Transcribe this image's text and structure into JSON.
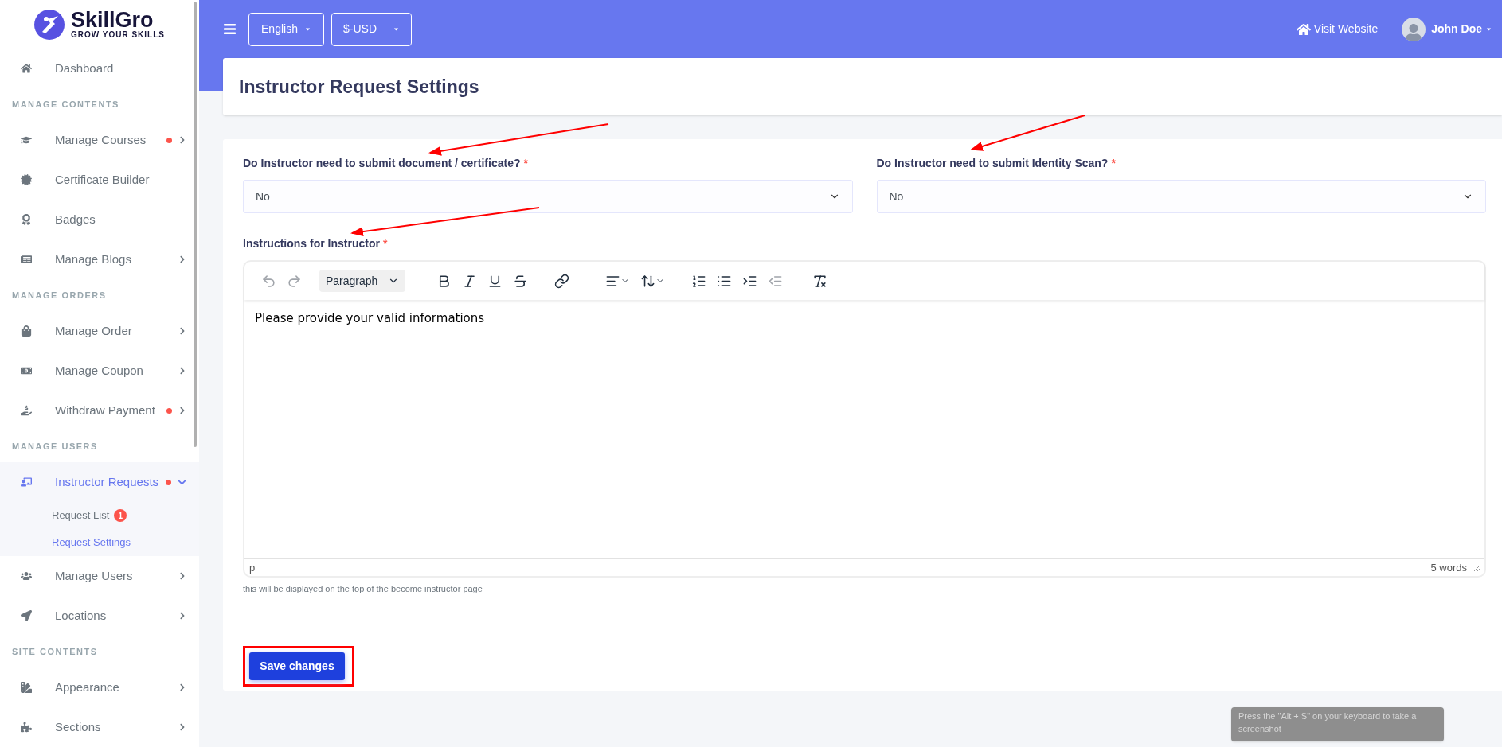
{
  "brand": {
    "name": "SkillGro",
    "tagline": "GROW YOUR SKILLS"
  },
  "sidebar": {
    "items": [
      {
        "kind": "link",
        "label": "Dashboard",
        "alert": false,
        "submenu": false,
        "expanded": false,
        "selected": false
      },
      {
        "kind": "heading",
        "label": "MANAGE CONTENTS"
      },
      {
        "kind": "link",
        "label": "Manage Courses",
        "alert": true,
        "submenu": true,
        "expanded": false,
        "selected": false
      },
      {
        "kind": "link",
        "label": "Certificate Builder",
        "alert": false,
        "submenu": false,
        "expanded": false,
        "selected": false
      },
      {
        "kind": "link",
        "label": "Badges",
        "alert": false,
        "submenu": false,
        "expanded": false,
        "selected": false
      },
      {
        "kind": "link",
        "label": "Manage Blogs",
        "alert": false,
        "submenu": true,
        "expanded": false,
        "selected": false
      },
      {
        "kind": "heading",
        "label": "MANAGE ORDERS"
      },
      {
        "kind": "link",
        "label": "Manage Order",
        "alert": false,
        "submenu": true,
        "expanded": false,
        "selected": false
      },
      {
        "kind": "link",
        "label": "Manage Coupon",
        "alert": false,
        "submenu": true,
        "expanded": false,
        "selected": false
      },
      {
        "kind": "link",
        "label": "Withdraw Payment",
        "alert": true,
        "submenu": true,
        "expanded": false,
        "selected": false
      },
      {
        "kind": "heading",
        "label": "MANAGE USERS"
      },
      {
        "kind": "link",
        "label": "Instructor Requests",
        "alert": true,
        "submenu": true,
        "expanded": true,
        "selected": true,
        "children": [
          {
            "label": "Request List",
            "badge": "1",
            "selected": false
          },
          {
            "label": "Request Settings",
            "selected": true
          }
        ]
      },
      {
        "kind": "link",
        "label": "Manage Users",
        "alert": false,
        "submenu": true,
        "expanded": false,
        "selected": false
      },
      {
        "kind": "link",
        "label": "Locations",
        "alert": false,
        "submenu": true,
        "expanded": false,
        "selected": false
      },
      {
        "kind": "heading",
        "label": "SITE CONTENTS"
      },
      {
        "kind": "link",
        "label": "Appearance",
        "alert": false,
        "submenu": true,
        "expanded": false,
        "selected": false
      },
      {
        "kind": "link",
        "label": "Sections",
        "alert": false,
        "submenu": true,
        "expanded": false,
        "selected": false
      }
    ]
  },
  "topbar": {
    "language": "English",
    "currency": "$-USD",
    "visit_website": "Visit Website",
    "user": "John Doe"
  },
  "page": {
    "title": "Instructor Request Settings"
  },
  "form": {
    "fields": [
      {
        "label": "Do Instructor need to submit document / certificate?",
        "required_mark": "*",
        "value": "No"
      },
      {
        "label": "Do Instructor need to submit Identity Scan?",
        "required_mark": "*",
        "value": "No"
      }
    ],
    "editor": {
      "label": "Instructions for Instructor",
      "required_mark": "*",
      "block_format": "Paragraph",
      "toolbar": [
        {
          "kind": "undo",
          "disabled": true
        },
        {
          "kind": "redo",
          "disabled": true
        },
        {
          "kind": "format",
          "disabled": false
        },
        {
          "kind": "bold",
          "disabled": false
        },
        {
          "kind": "italic",
          "disabled": false
        },
        {
          "kind": "underline",
          "disabled": false
        },
        {
          "kind": "strike",
          "disabled": false
        },
        {
          "kind": "link",
          "disabled": false
        },
        {
          "kind": "align",
          "disabled": false
        },
        {
          "kind": "lineheight",
          "disabled": false
        },
        {
          "kind": "numlist",
          "disabled": false
        },
        {
          "kind": "bullist",
          "disabled": false
        },
        {
          "kind": "indent",
          "disabled": false
        },
        {
          "kind": "outdent",
          "disabled": true
        },
        {
          "kind": "clear",
          "disabled": false
        }
      ],
      "content": "Please provide your valid informations",
      "path": "p",
      "word_count": "5 words",
      "help": "this will be displayed on the top of the become instructor page"
    },
    "save_button": "Save changes"
  },
  "toast": "Press the \"Alt + S\" on your keyboard to take a screenshot"
}
